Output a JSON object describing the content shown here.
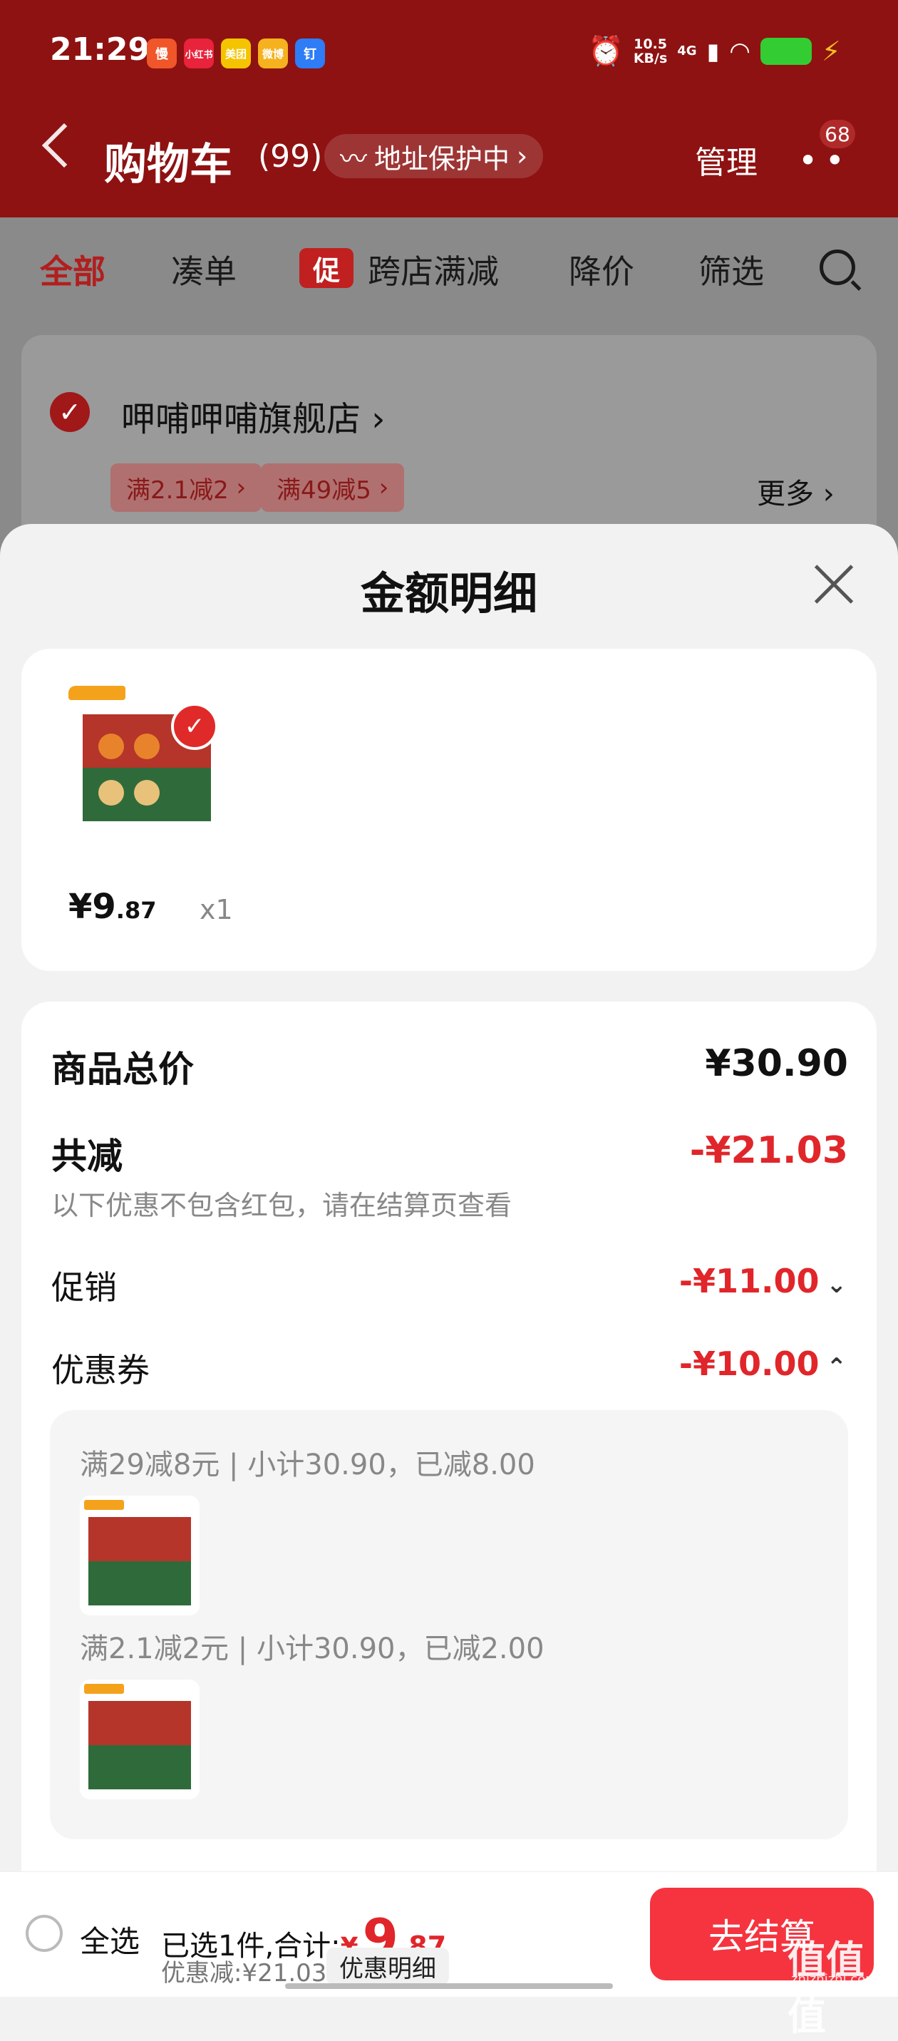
{
  "status_bar": {
    "time": "21:29",
    "net_speed": "10.5",
    "net_unit": "KB/s",
    "signal": "4G",
    "apps": [
      {
        "label": "慢",
        "color": "#f0562a"
      },
      {
        "label": "小红书",
        "color": "#e8233b"
      },
      {
        "label": "美团",
        "color": "#f5c400"
      },
      {
        "label": "微博",
        "color": "#f5b21e"
      },
      {
        "label": "钉",
        "color": "#2e7cf6"
      }
    ]
  },
  "nav": {
    "title": "购物车",
    "count": "(99)",
    "address_pill": "地址保护中",
    "manage": "管理",
    "more_badge": "68"
  },
  "filter_tabs": [
    "全部",
    "凑单",
    "跨店满减",
    "降价",
    "筛选"
  ],
  "promo_tag": "促",
  "store": {
    "name": "呷哺呷哺旗舰店",
    "coupons": [
      "满2.1减2",
      "满49减5"
    ],
    "more": "更多"
  },
  "sheet": {
    "title": "金额明细",
    "item": {
      "price_int": "¥9",
      "price_dec": ".87",
      "qty": "x1"
    },
    "rows": {
      "total_label": "商品总价",
      "total_value": "¥30.90",
      "reduce_label": "共减",
      "reduce_value": "-¥21.03",
      "note": "以下优惠不包含红包，请在结算页查看",
      "promo_label": "促销",
      "promo_value": "-¥11.00",
      "coupon_label": "优惠券",
      "coupon_value": "-¥10.00"
    },
    "coupon_details": [
      "满29减8元 | 小计30.90，已减8.00",
      "满2.1减2元 | 小计30.90，已减2.00"
    ]
  },
  "bottom": {
    "select_all": "全选",
    "summary_label": "已选1件,合计:",
    "currency": "¥",
    "total_int": "9",
    "total_dec": ".87",
    "discount": "优惠减:¥21.03",
    "detail_btn": "优惠明细",
    "checkout": "去结算"
  },
  "watermark": "值值值",
  "watermark_sub": "zhizhizhi.com",
  "colors": {
    "header": "#8e1212",
    "accent_red": "#e0262a",
    "checkout": "#f5343f"
  }
}
